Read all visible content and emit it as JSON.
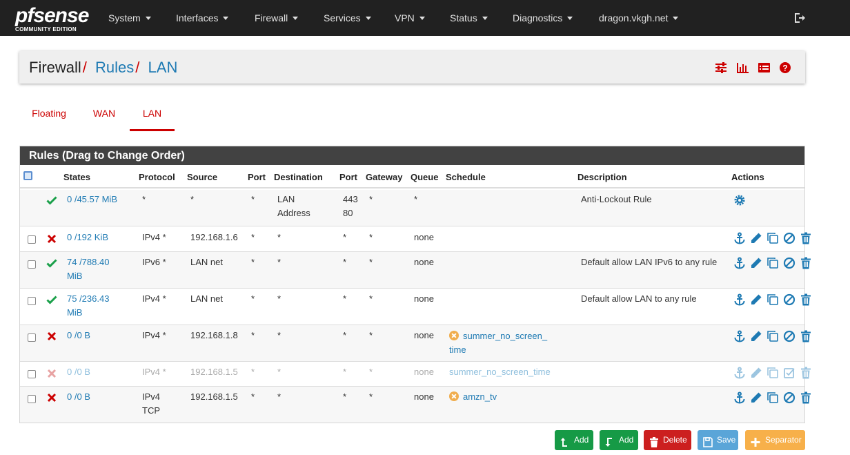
{
  "brand": {
    "logo_mark": "pfsense",
    "edition": "COMMUNITY EDITION"
  },
  "nav": {
    "items": [
      "System",
      "Interfaces",
      "Firewall",
      "Services",
      "VPN",
      "Status",
      "Diagnostics",
      "dragon.vkgh.net"
    ]
  },
  "breadcrumb": {
    "root": "Firewall",
    "level1": "Rules",
    "level2": "LAN",
    "separator": "/"
  },
  "tabs": [
    "Floating",
    "WAN",
    "LAN"
  ],
  "active_tab": "LAN",
  "panel": {
    "title": "Rules (Drag to Change Order)"
  },
  "columns": [
    "States",
    "Protocol",
    "Source",
    "Port",
    "Destination",
    "Port",
    "Gateway",
    "Queue",
    "Schedule",
    "Description",
    "Actions"
  ],
  "rules": [
    {
      "status": "pass",
      "states": "0 /45.57 MiB",
      "protocol": "*",
      "source": "*",
      "src_port": "*",
      "destination": "LAN Address",
      "dst_port": "443 80",
      "gateway": "*",
      "queue": "*",
      "schedule": "",
      "description": "Anti-Lockout Rule",
      "enabled": true
    },
    {
      "status": "block",
      "states": "0 /192 KiB",
      "protocol": "IPv4 *",
      "source": "192.168.1.6",
      "src_port": "*",
      "destination": "*",
      "dst_port": "*",
      "gateway": "*",
      "queue": "none",
      "schedule": "",
      "description": "",
      "enabled": true
    },
    {
      "status": "pass",
      "states": "74 /788.40 MiB",
      "protocol": "IPv6 *",
      "source": "LAN net",
      "src_port": "*",
      "destination": "*",
      "dst_port": "*",
      "gateway": "*",
      "queue": "none",
      "schedule": "",
      "description": "Default allow LAN IPv6 to any rule",
      "enabled": true
    },
    {
      "status": "pass",
      "states": "75 /236.43 MiB",
      "protocol": "IPv4 *",
      "source": "LAN net",
      "src_port": "*",
      "destination": "*",
      "dst_port": "*",
      "gateway": "*",
      "queue": "none",
      "schedule": "",
      "description": "Default allow LAN to any rule",
      "enabled": true
    },
    {
      "status": "block",
      "states": "0 /0 B",
      "protocol": "IPv4 *",
      "source": "192.168.1.8",
      "src_port": "*",
      "destination": "*",
      "dst_port": "*",
      "gateway": "*",
      "queue": "none",
      "schedule": "summer_no_screen_ time",
      "description": "",
      "enabled": true
    },
    {
      "status": "block",
      "states": "0 /0 B",
      "protocol": "IPv4 *",
      "source": "192.168.1.5",
      "src_port": "*",
      "destination": "*",
      "dst_port": "*",
      "gateway": "*",
      "queue": "none",
      "schedule": "summer_no_screen_time",
      "description": "",
      "enabled": false
    },
    {
      "status": "block",
      "states": "0 /0 B",
      "protocol": "IPv4 TCP",
      "source": "192.168.1.5",
      "src_port": "*",
      "destination": "*",
      "dst_port": "*",
      "gateway": "*",
      "queue": "none",
      "schedule": "amzn_tv",
      "description": "",
      "enabled": true
    }
  ],
  "buttons": {
    "add_top": "Add",
    "add_bottom": "Add",
    "delete": "Delete",
    "save": "Save",
    "separator": "Separator"
  },
  "colors": {
    "navbar": "#212121",
    "accent_red": "#cc0000",
    "link_blue": "#1e7ab3",
    "pass_green": "#1aa04a",
    "block_red": "#cc0000"
  }
}
